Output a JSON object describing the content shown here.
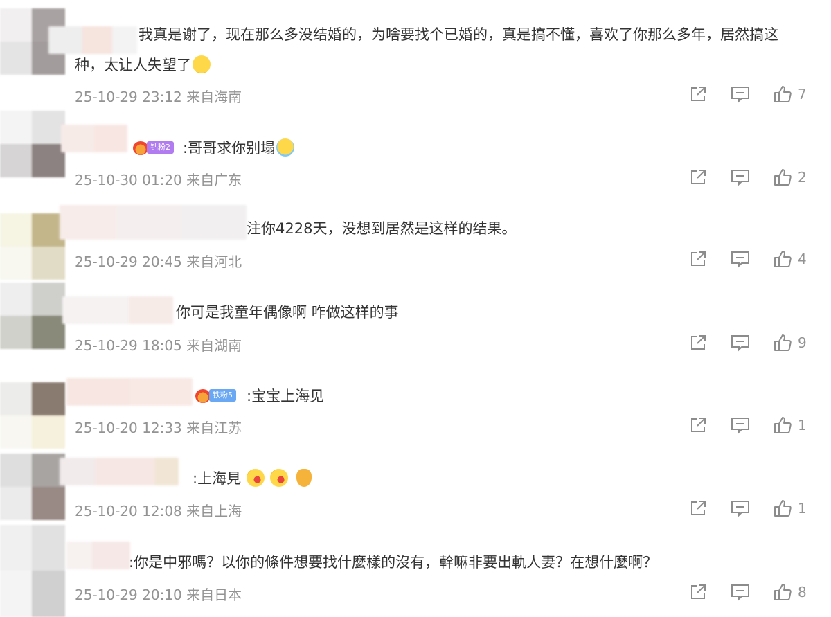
{
  "comments": [
    {
      "text": "我真是谢了，现在那么多没结婚的，为啥要找个已婚的，真是搞不懂，喜欢了你那么多年，居然搞这种，太让人失望了",
      "time": "25-10-29 23:12",
      "location": "来自海南",
      "likes": "7"
    },
    {
      "badge": "钻粉2",
      "text": ":哥哥求你别塌",
      "time": "25-10-30 01:20",
      "location": "来自广东",
      "likes": "2"
    },
    {
      "text": "注你4228天，没想到居然是这样的结果。",
      "time": "25-10-29 20:45",
      "location": "来自河北",
      "likes": "4"
    },
    {
      "text": "你可是我童年偶像啊  咋做这样的事",
      "time": "25-10-29 18:05",
      "location": "来自湖南",
      "likes": "9"
    },
    {
      "badge": "铁粉5",
      "text": ":宝宝上海见",
      "time": "25-10-20 12:33",
      "location": "来自江苏",
      "likes": "1"
    },
    {
      "text": ":上海見",
      "time": "25-10-20 12:08",
      "location": "来自上海",
      "likes": "1"
    },
    {
      "text": ":你是中邪嗎？以你的條件想要找什麼樣的沒有，幹嘛非要出軌人妻？在想什麼啊？",
      "time": "25-10-29 20:10",
      "location": "来自日本",
      "likes": "8"
    }
  ],
  "icons": [
    "share-icon",
    "comment-icon",
    "like-icon"
  ],
  "colors": {
    "meta": "#939393",
    "text": "#333333",
    "badge_purple": "#b07cf0",
    "badge_blue": "#6aa8f3"
  }
}
